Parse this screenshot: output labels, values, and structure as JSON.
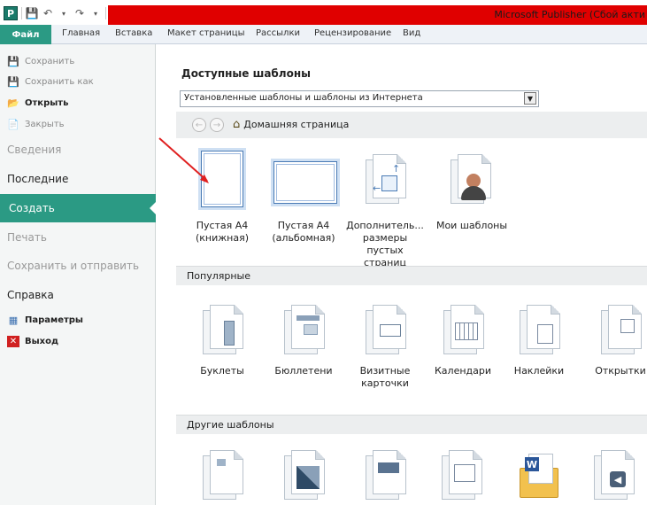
{
  "window": {
    "title": "Microsoft Publisher (Сбой акти"
  },
  "quick_access": {
    "app_letter": "P",
    "save_icon": "save-icon",
    "undo_icon": "undo-icon",
    "redo_icon": "redo-icon"
  },
  "ribbon": {
    "tabs": [
      {
        "label": "Файл"
      },
      {
        "label": "Главная"
      },
      {
        "label": "Вставка"
      },
      {
        "label": "Макет страницы"
      },
      {
        "label": "Рассылки"
      },
      {
        "label": "Рецензирование"
      },
      {
        "label": "Вид"
      }
    ]
  },
  "nav": {
    "save": "Сохранить",
    "save_as": "Сохранить как",
    "open": "Открыть",
    "close": "Закрыть",
    "info": "Сведения",
    "recent": "Последние",
    "create": "Создать",
    "print": "Печать",
    "save_send": "Сохранить и отправить",
    "help": "Справка",
    "options": "Параметры",
    "exit": "Выход"
  },
  "main": {
    "heading": "Доступные шаблоны",
    "dropdown_value": "Установленные шаблоны и шаблоны из Интернета",
    "home_label": "Домашняя страница",
    "blank": [
      {
        "line1": "Пустая А4",
        "line2": "(книжная)"
      },
      {
        "line1": "Пустая А4",
        "line2": "(альбомная)"
      },
      {
        "line1": "Дополнитель...",
        "line2": "размеры",
        "line3": "пустых страниц"
      },
      {
        "line1": "Мои шаблоны"
      }
    ],
    "popular_title": "Популярные",
    "popular": [
      {
        "line1": "Буклеты"
      },
      {
        "line1": "Бюллетени"
      },
      {
        "line1": "Визитные",
        "line2": "карточки"
      },
      {
        "line1": "Календари"
      },
      {
        "line1": "Наклейки"
      },
      {
        "line1": "Открытки"
      }
    ],
    "other_title": "Другие шаблоны"
  },
  "colors": {
    "accent": "#2b9a84",
    "titlebar_red": "#e00000",
    "arrow": "#e02020"
  }
}
